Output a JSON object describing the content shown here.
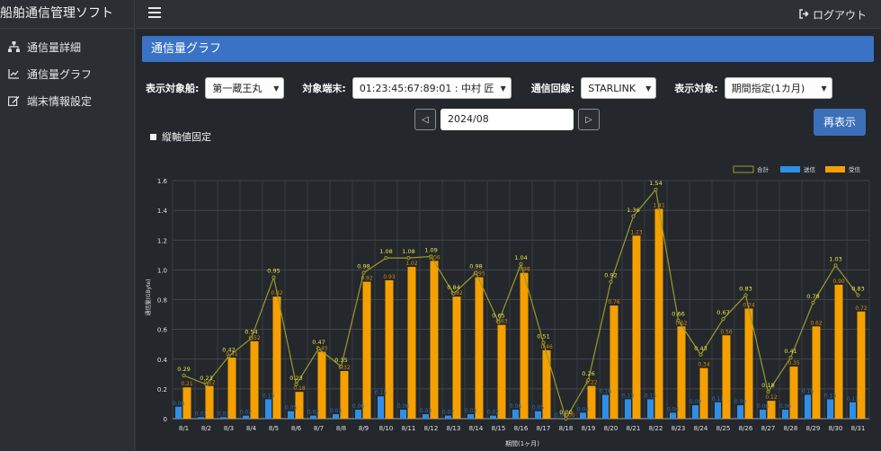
{
  "app": {
    "title": "船舶通信管理ソフト"
  },
  "sidebar": {
    "items": [
      {
        "label": "通信量詳細",
        "icon": "sitemap-icon"
      },
      {
        "label": "通信量グラフ",
        "icon": "line-chart-icon"
      },
      {
        "label": "端末情報設定",
        "icon": "edit-icon"
      }
    ]
  },
  "topbar": {
    "logout_label": "ログアウト"
  },
  "panel": {
    "title": "通信量グラフ"
  },
  "filters": {
    "ship_label": "表示対象船:",
    "ship_value": "第一蔵王丸",
    "terminal_label": "対象端末:",
    "terminal_value": "01:23:45:67:89:01 : 中村 匠",
    "line_label": "通信回線:",
    "line_value": "STARLINK",
    "target_label": "表示対象:",
    "target_value": "期間指定(1カ月)"
  },
  "period": {
    "month": "2024/08"
  },
  "buttons": {
    "redisplay": "再表示"
  },
  "options": {
    "fix_axis_label": "縦軸値固定"
  },
  "colors": {
    "total": "#9a9a2a",
    "send": "#2f8ee8",
    "recv": "#f5a000",
    "header": "#3a73c6"
  },
  "chart_data": {
    "type": "bar",
    "xlabel": "期間(1ヶ月)",
    "ylabel": "通信量(GByte)",
    "ylim": [
      0,
      1.6
    ],
    "yticks": [
      "0",
      "0.2",
      "0.4",
      "0.6",
      "0.8",
      "1.0",
      "1.2",
      "1.4",
      "1.6"
    ],
    "grid": true,
    "legend_position": "top-right",
    "categories": [
      "8/1",
      "8/2",
      "8/3",
      "8/4",
      "8/5",
      "8/6",
      "8/7",
      "8/8",
      "8/9",
      "8/10",
      "8/11",
      "8/12",
      "8/13",
      "8/14",
      "8/15",
      "8/16",
      "8/17",
      "8/18",
      "8/19",
      "8/20",
      "8/21",
      "8/22",
      "8/23",
      "8/24",
      "8/25",
      "8/26",
      "8/27",
      "8/28",
      "8/29",
      "8/30",
      "8/31"
    ],
    "series": [
      {
        "name": "合計",
        "kind": "line",
        "values": [
          0.29,
          0.23,
          0.42,
          0.54,
          0.95,
          0.23,
          0.47,
          0.35,
          0.98,
          1.08,
          1.08,
          1.09,
          0.84,
          0.98,
          0.65,
          1.04,
          0.51,
          0.0,
          0.26,
          0.92,
          1.36,
          1.54,
          0.66,
          0.43,
          0.67,
          0.83,
          0.18,
          0.41,
          0.78,
          1.03,
          0.83
        ]
      },
      {
        "name": "送信",
        "kind": "bar",
        "values": [
          0.08,
          0.01,
          0.01,
          0.02,
          0.13,
          0.05,
          0.02,
          0.03,
          0.06,
          0.15,
          0.06,
          0.03,
          0.02,
          0.03,
          0.02,
          0.06,
          0.05,
          0.0,
          0.04,
          0.16,
          0.13,
          0.13,
          0.04,
          0.09,
          0.11,
          0.09,
          0.06,
          0.06,
          0.16,
          0.13,
          0.11
        ]
      },
      {
        "name": "受信",
        "kind": "bar",
        "values": [
          0.21,
          0.22,
          0.41,
          0.52,
          0.82,
          0.18,
          0.45,
          0.32,
          0.92,
          0.93,
          1.02,
          1.06,
          0.82,
          0.95,
          0.63,
          0.98,
          0.46,
          0.0,
          0.22,
          0.76,
          1.23,
          1.41,
          0.62,
          0.34,
          0.56,
          0.74,
          0.12,
          0.35,
          0.62,
          0.9,
          0.72
        ]
      }
    ]
  }
}
